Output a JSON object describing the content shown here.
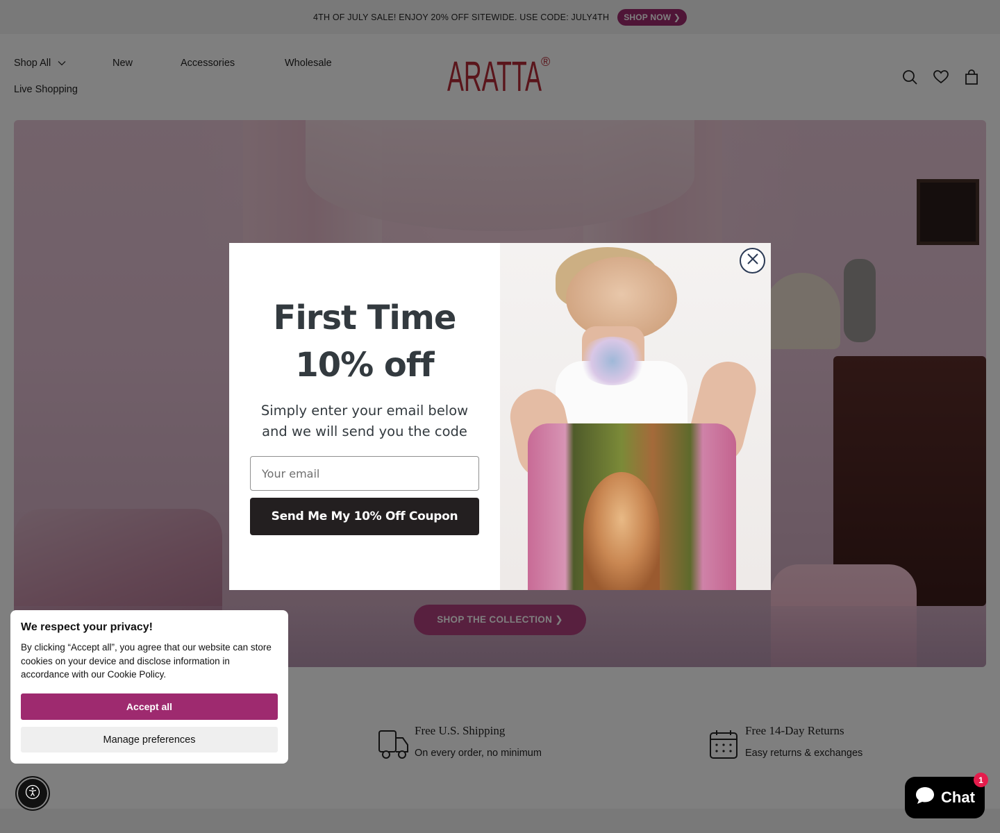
{
  "announcement": {
    "text": "4TH OF JULY SALE! ENJOY 20% OFF SITEWIDE. USE CODE: JULY4TH",
    "button_label": "SHOP NOW ❯"
  },
  "header": {
    "logo_text": "ARATTA",
    "logo_mark": "®",
    "nav": [
      {
        "label": "Shop All",
        "icon": "chevron-down-icon"
      },
      {
        "label": "New"
      },
      {
        "label": "Accessories"
      },
      {
        "label": "Wholesale"
      },
      {
        "label": "Live Shopping"
      }
    ],
    "icons": [
      "search-icon",
      "heart-icon",
      "bag-icon"
    ]
  },
  "hero": {
    "cta_label": "SHOP THE COLLECTION ❯"
  },
  "features": [
    {
      "icon": "truck-icon",
      "title": "Free U.S. Shipping",
      "subtitle": "On every order, no minimum"
    },
    {
      "icon": "calendar-icon",
      "title": "Free 14-Day Returns",
      "subtitle": "Easy returns & exchanges"
    }
  ],
  "popup": {
    "heading_line1": "First Time",
    "heading_line2": "10% off",
    "subtitle": "Simply enter your email below and we will send you the code",
    "email_placeholder": "Your email",
    "submit_label": "Send Me My 10% Off Coupon",
    "close_icon": "close-icon"
  },
  "cookie_banner": {
    "title": "We respect your privacy!",
    "body": "By clicking “Accept all”, you agree that our website can store cookies on your device and disclose information in accordance with our Cookie Policy.",
    "accept_label": "Accept all",
    "manage_label": "Manage preferences"
  },
  "chat_widget": {
    "label": "Chat",
    "badge_count": "1"
  },
  "colors": {
    "brand": "#9e2a6f",
    "logo": "#b52a36",
    "dark_button": "#231f20",
    "badge": "#e51c4c"
  }
}
